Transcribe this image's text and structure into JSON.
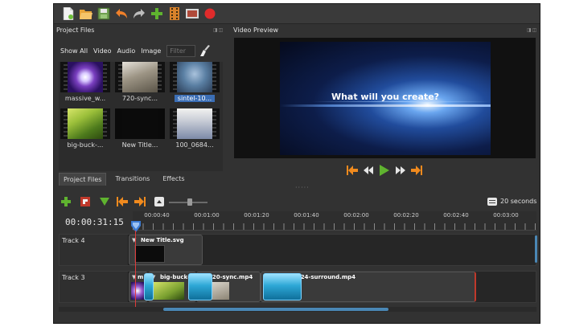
{
  "colors": {
    "accent": "#3b6eb5",
    "playhead": "#e03a3a",
    "record": "#e02b2b",
    "transport": "#f08a1e",
    "play": "#5fb32f"
  },
  "toolbar": {
    "icons": [
      "new-project-icon",
      "open-project-icon",
      "save-project-icon",
      "undo-icon",
      "redo-icon",
      "import-files-icon",
      "choose-profile-icon",
      "fullscreen-icon",
      "export-video-icon"
    ]
  },
  "project_files": {
    "title": "Project Files",
    "filters": {
      "show_all": "Show All",
      "video": "Video",
      "audio": "Audio",
      "image": "Image"
    },
    "filter_placeholder": "Filter",
    "files": [
      {
        "name": "massive_w...",
        "selected": false
      },
      {
        "name": "720-sync...",
        "selected": false
      },
      {
        "name": "sintel-10...",
        "selected": true
      },
      {
        "name": "big-buck-...",
        "selected": false
      },
      {
        "name": "New Title...",
        "selected": false
      },
      {
        "name": "100_0684...",
        "selected": false
      }
    ],
    "tabs": [
      "Project Files",
      "Transitions",
      "Effects"
    ]
  },
  "preview": {
    "title": "Video Preview",
    "overlay_text": "What will you create?",
    "controls": [
      "jump-start-icon",
      "rewind-icon",
      "play-icon",
      "fast-forward-icon",
      "jump-end-icon"
    ]
  },
  "timeline": {
    "zoom_label": "20 seconds",
    "timecode": "00:00:31:15",
    "ticks": [
      "00:00:40",
      "00:01:00",
      "00:01:20",
      "00:01:40",
      "00:02:00",
      "00:02:20",
      "00:02:40",
      "00:03:00"
    ],
    "tracks": [
      {
        "name": "Track 4",
        "clips": [
          "New Title.svg"
        ]
      },
      {
        "name": "Track 3",
        "clips": [
          "m",
          "big-buck-",
          "720-sync.mp4",
          "sintel-1024-surround.mp4"
        ]
      }
    ]
  }
}
